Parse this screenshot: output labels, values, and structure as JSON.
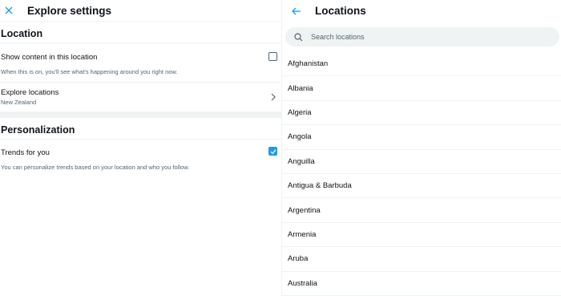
{
  "colors": {
    "accent": "#1d9bf0",
    "text_primary": "#0f1419",
    "text_secondary": "#536471",
    "divider": "#eff3f4"
  },
  "left_panel": {
    "close_icon": "close-icon",
    "title": "Explore settings",
    "location_section": {
      "title": "Location",
      "show_content": {
        "label": "Show content in this location",
        "description": "When this is on, you'll see what's happening around you right now.",
        "checked": false
      },
      "explore_locations": {
        "label": "Explore locations",
        "value": "New Zealand",
        "icon": "chevron-right-icon"
      }
    },
    "personalization_section": {
      "title": "Personalization",
      "trends": {
        "label": "Trends for you",
        "description": "You can personalize trends based on your location and who you follow.",
        "checked": true
      }
    }
  },
  "right_panel": {
    "back_icon": "back-arrow-icon",
    "title": "Locations",
    "search": {
      "placeholder": "Search locations",
      "value": "",
      "icon": "search-icon"
    },
    "locations": [
      "Afghanistan",
      "Albania",
      "Algeria",
      "Angola",
      "Anguilla",
      "Antigua & Barbuda",
      "Argentina",
      "Armenia",
      "Aruba",
      "Australia"
    ]
  }
}
